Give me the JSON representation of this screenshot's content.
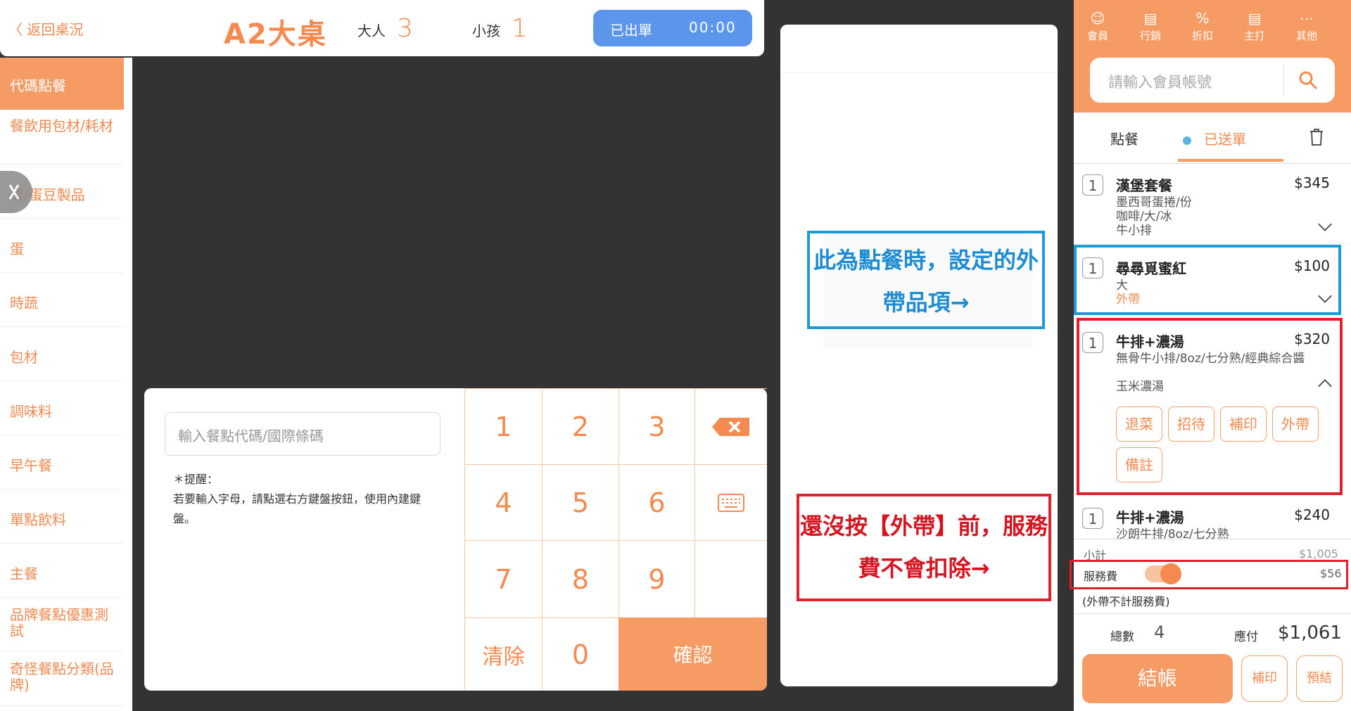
{
  "header": {
    "back_label": "〈 返回桌況",
    "table_name": "A2大桌",
    "adult_label": "大人",
    "adult_count": "3",
    "child_label": "小孩",
    "child_count": "1",
    "order_status": "已出單",
    "timer": "00:00"
  },
  "sidebar": {
    "items": [
      {
        "label": "代碼點餐"
      },
      {
        "label": "餐飲用包材/耗材"
      },
      {
        "label": "蛋/蛋豆製品"
      },
      {
        "label": "蛋"
      },
      {
        "label": "時蔬"
      },
      {
        "label": "包材"
      },
      {
        "label": "調味料"
      },
      {
        "label": "早午餐"
      },
      {
        "label": "單點飲料"
      },
      {
        "label": "主餐"
      },
      {
        "label": "品牌餐點優惠測試"
      },
      {
        "label": "奇怪餐點分類(品牌)"
      }
    ]
  },
  "keypad_panel": {
    "code_placeholder": "輸入餐點代碼/國際條碼",
    "tip_title": "＊提醒：",
    "tip_body": "若要輸入字母，請點選右方鍵盤按鈕，使用內建鍵盤。",
    "keys": [
      "1",
      "2",
      "3",
      "4",
      "5",
      "6",
      "7",
      "8",
      "9",
      "0"
    ],
    "clear_label": "清除",
    "confirm_label": "確認"
  },
  "annotations": {
    "blue_note": "此為點餐時，設定的外帶品項→",
    "red_note": "還沒按【外帶】前，服務費不會扣除→"
  },
  "right_panel": {
    "toolbar": [
      {
        "icon": "member-icon",
        "label": "會員"
      },
      {
        "icon": "marketing-icon",
        "label": "行銷"
      },
      {
        "icon": "discount-icon",
        "label": "折扣"
      },
      {
        "icon": "host-icon",
        "label": "主打"
      },
      {
        "icon": "more-icon",
        "label": "其他"
      }
    ],
    "search_placeholder": "請輸入會員帳號",
    "tabs": {
      "order": "點餐",
      "sent": "已送單"
    },
    "items": [
      {
        "qty": "1",
        "name": "漢堡套餐",
        "price": "$345",
        "details": [
          "墨西哥蛋捲/份",
          "咖啡/大/冰",
          "牛小排"
        ]
      },
      {
        "qty": "1",
        "name": "尋尋覓蜜紅",
        "price": "$100",
        "details": [
          "大"
        ],
        "takeout": "外帶"
      },
      {
        "qty": "1",
        "name": "牛排+濃湯",
        "price": "$320",
        "details": [
          "無骨牛小排/8oz/七分熟/經典綜合醬",
          "玉米濃湯"
        ],
        "actions": [
          "退菜",
          "招待",
          "補印",
          "外帶",
          "備註"
        ]
      },
      {
        "qty": "1",
        "name": "牛排+濃湯",
        "price": "$240",
        "details": [
          "沙朗牛排/8oz/七分熟"
        ]
      }
    ],
    "subtotal_label": "小計",
    "subtotal_value": "$1,005",
    "service_label": "服務費",
    "service_value": "$56",
    "service_note": "(外帶不計服務費)",
    "total_count_label": "總數",
    "total_count": "4",
    "payable_label": "應付",
    "payable_value": "$1,061",
    "pay_label": "結帳",
    "reprint_label": "補印",
    "prepay_label": "預結"
  }
}
